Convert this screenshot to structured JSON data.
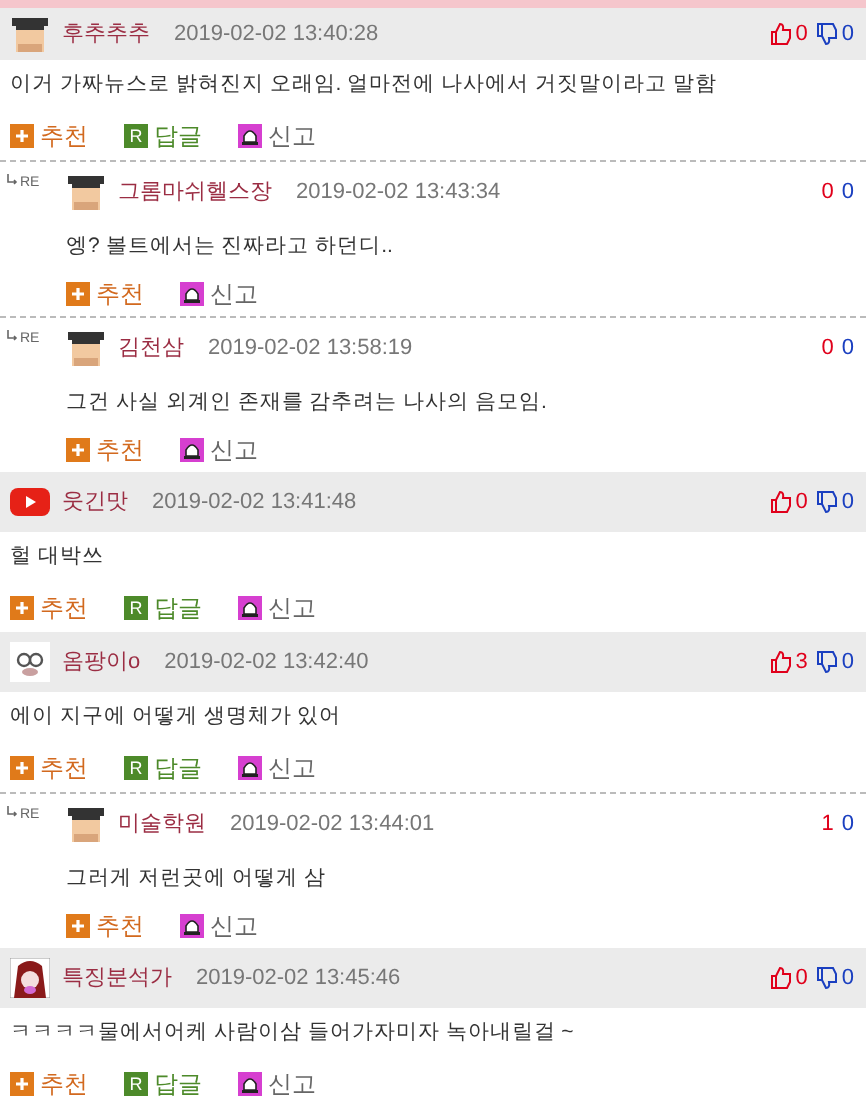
{
  "comments": [
    {
      "avatar": {
        "kind": "student"
      },
      "author": "후추추추",
      "date": "2019-02-02 13:40:28",
      "up": "0",
      "down": "0",
      "text": "이거 가짜뉴스로 밝혀진지 오래임. 얼마전에 나사에서 거짓말이라고 말함",
      "actions": [
        {
          "kind": "recommend",
          "label": "추천"
        },
        {
          "kind": "reply",
          "badge": "R",
          "label": "답글"
        },
        {
          "kind": "report",
          "label": "신고"
        }
      ],
      "replies": [
        {
          "marker": "RE",
          "avatar": {
            "kind": "student"
          },
          "author": "그롬마쉬헬스장",
          "date": "2019-02-02 13:43:34",
          "up": "0",
          "down": "0",
          "text": "엥? 볼트에서는 진짜라고 하던디..",
          "actions": [
            {
              "kind": "recommend",
              "label": "추천"
            },
            {
              "kind": "report",
              "label": "신고"
            }
          ]
        },
        {
          "marker": "RE",
          "avatar": {
            "kind": "student"
          },
          "author": "김천삼",
          "date": "2019-02-02 13:58:19",
          "up": "0",
          "down": "0",
          "text": "그건 사실 외계인 존재를 감추려는 나사의 음모임.",
          "actions": [
            {
              "kind": "recommend",
              "label": "추천"
            },
            {
              "kind": "report",
              "label": "신고"
            }
          ]
        }
      ]
    },
    {
      "avatar": {
        "kind": "play"
      },
      "author": "웃긴맛",
      "date": "2019-02-02 13:41:48",
      "up": "0",
      "down": "0",
      "text": "헐 대박쓰",
      "actions": [
        {
          "kind": "recommend",
          "label": "추천"
        },
        {
          "kind": "reply",
          "badge": "R",
          "label": "답글"
        },
        {
          "kind": "report",
          "label": "신고"
        }
      ]
    },
    {
      "avatar": {
        "kind": "doodle"
      },
      "author": "옴팡이o",
      "date": "2019-02-02 13:42:40",
      "up": "3",
      "down": "0",
      "text": "에이 지구에 어떻게 생명체가 있어",
      "actions": [
        {
          "kind": "recommend",
          "label": "추천"
        },
        {
          "kind": "reply",
          "badge": "R",
          "label": "답글"
        },
        {
          "kind": "report",
          "label": "신고"
        }
      ],
      "replies": [
        {
          "marker": "RE",
          "avatar": {
            "kind": "student"
          },
          "author": "미술학원",
          "date": "2019-02-02 13:44:01",
          "up": "1",
          "down": "0",
          "text": "그러게 저런곳에 어떻게 삼",
          "actions": [
            {
              "kind": "recommend",
              "label": "추천"
            },
            {
              "kind": "report",
              "label": "신고"
            }
          ]
        }
      ]
    },
    {
      "avatar": {
        "kind": "figure"
      },
      "author": "특징분석가",
      "date": "2019-02-02 13:45:46",
      "up": "0",
      "down": "0",
      "text": "ㅋㅋㅋㅋ물에서어케 사람이삼 들어가자미자 녹아내릴걸 ~",
      "actions": [
        {
          "kind": "recommend",
          "label": "추천"
        },
        {
          "kind": "reply",
          "badge": "R",
          "label": "답글"
        },
        {
          "kind": "report",
          "label": "신고"
        }
      ]
    }
  ]
}
